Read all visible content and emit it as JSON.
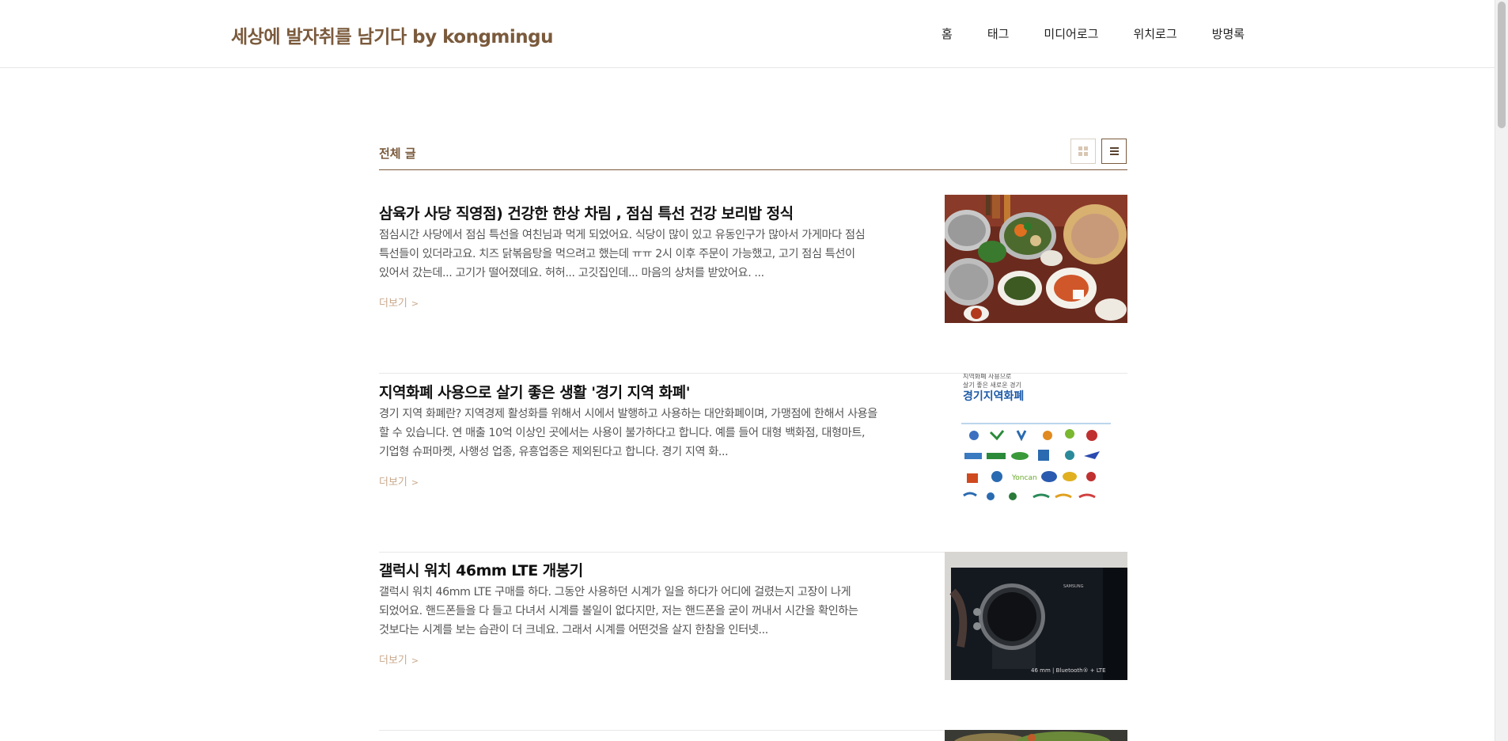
{
  "header": {
    "blog_title": "세상에 발자취를 남기다 by kongmingu",
    "nav": [
      "홈",
      "태그",
      "미디어로그",
      "위치로그",
      "방명록"
    ]
  },
  "list": {
    "title": "전체 글",
    "view_modes": [
      "grid-view",
      "list-view"
    ],
    "active_view": "list-view"
  },
  "posts": [
    {
      "title": "삼육가 사당 직영점) 건강한 한상 차림 , 점심 특선 건강 보리밥 정식",
      "summary": "점심시간 사당에서 점심 특선을 여친님과 먹게 되었어요. 식당이 많이 있고 유동인구가 많아서 가게마다 점심 특선들이 있더라고요. 치즈 닭볶음탕을 먹으려고 했는데 ㅠㅠ 2시 이후 주문이 가능했고, 고기 점심 특선이 있어서 갔는데... 고기가 떨어졌데요. 허허... 고깃집인데... 마음의 상처를 받았어요. ...",
      "more": "더보기",
      "thumb": "food-photo"
    },
    {
      "title": "지역화폐 사용으로 살기 좋은 생활 '경기 지역 화폐'",
      "summary": "경기 지역 화폐란? 지역경제 활성화를 위해서 시에서 발행하고 사용하는 대안화폐이며, 가맹점에 한해서 사용을 할 수 있습니다. 연 매출 10억 이상인 곳에서는 사용이 불가하다고 합니다. 예를 들어 대형 백화점, 대형마트, 기업형 슈퍼마켓, 사행성 업종, 유흥업종은 제외된다고 합니다. 경기 지역 화...",
      "more": "더보기",
      "thumb_text": {
        "line1": "지역화폐 사용으로",
        "line2": "살기 좋은 새로운 경기",
        "heading": "경기지역화폐"
      }
    },
    {
      "title": "갤럭시 워치 46mm LTE 개봉기",
      "summary": "갤럭시 워치 46mm LTE 구매를 하다. 그동안 사용하던 시계가 일을 하다가 어디에 걸렸는지 고장이 나게 되었어요. 핸드폰들을 다 들고 다녀서 시계를 볼일이 없다지만, 저는 핸드폰을 굳이 꺼내서 시간을 확인하는 것보다는 시계를 보는 습관이 더 크네요. 그래서 시계를 어떤것을 살지 한참을 인터넷...",
      "more": "더보기",
      "thumb_text": {
        "brand": "SAMSUNG",
        "caption": "46 mm | Bluetooth® + LTE"
      }
    },
    {
      "title": "",
      "thumb": "food-photo-partial"
    }
  ],
  "colors": {
    "brand": "#7a5a3c",
    "more_link": "#c9a98c",
    "title": "#111111",
    "summary": "#555555"
  }
}
